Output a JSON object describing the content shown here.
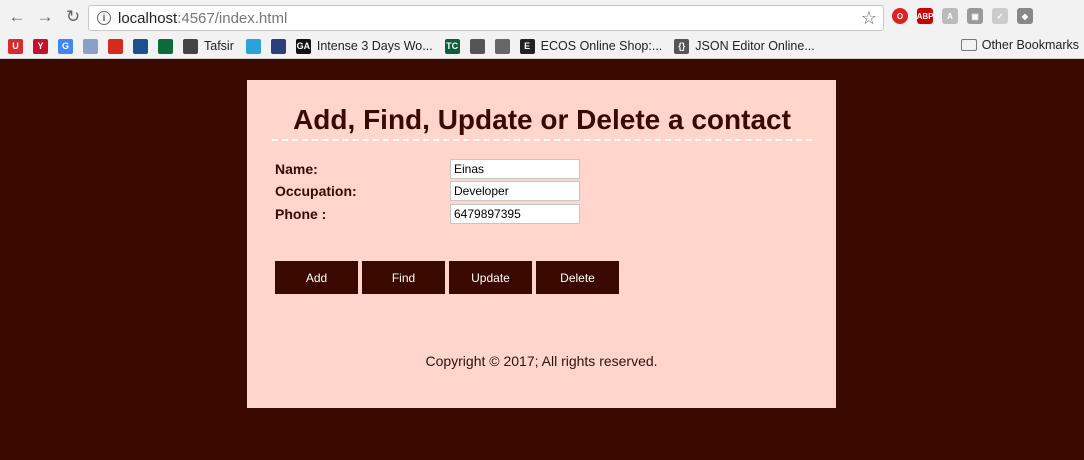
{
  "browser": {
    "url_host": "localhost",
    "url_rest": ":4567/index.html",
    "bookmarks": [
      {
        "icon": "U",
        "label": "",
        "color": "#d92b2b"
      },
      {
        "icon": "Y",
        "label": "",
        "color": "#c8102e"
      },
      {
        "icon": "G",
        "label": "",
        "color": "#4285f4"
      },
      {
        "icon": "",
        "label": "",
        "color": "#8aa0c8"
      },
      {
        "icon": "",
        "label": "",
        "color": "#d52b1e"
      },
      {
        "icon": "",
        "label": "",
        "color": "#1d4f91"
      },
      {
        "icon": "",
        "label": "",
        "color": "#0b6b3a"
      },
      {
        "icon": "",
        "label": "Tafsir",
        "color": "#444444"
      },
      {
        "icon": "",
        "label": "",
        "color": "#2aa3d8"
      },
      {
        "icon": "",
        "label": "",
        "color": "#2a3f7a"
      },
      {
        "icon": "GA",
        "label": "Intense 3 Days Wo...",
        "color": "#111111"
      },
      {
        "icon": "TC",
        "label": "",
        "color": "#0b5f3a"
      },
      {
        "icon": "",
        "label": "",
        "color": "#555555"
      },
      {
        "icon": "",
        "label": "",
        "color": "#666666"
      },
      {
        "icon": "E",
        "label": "ECOS Online Shop:...",
        "color": "#222222"
      },
      {
        "icon": "{}",
        "label": "JSON Editor Online...",
        "color": "#555555"
      }
    ],
    "other_bookmarks": "Other Bookmarks"
  },
  "page": {
    "title": "Add, Find, Update or Delete a contact",
    "fields": [
      {
        "label": "Name:",
        "value": "Einas"
      },
      {
        "label": "Occupation:",
        "value": "Developer"
      },
      {
        "label": "Phone :",
        "value": "6479897395"
      }
    ],
    "buttons": {
      "add": "Add",
      "find": "Find",
      "update": "Update",
      "delete": "Delete"
    },
    "copyright": "Copyright © 2017; All rights reserved."
  },
  "colors": {
    "background": "#3a0a00",
    "card": "#ffd5cc",
    "button": "#3a0a00"
  }
}
